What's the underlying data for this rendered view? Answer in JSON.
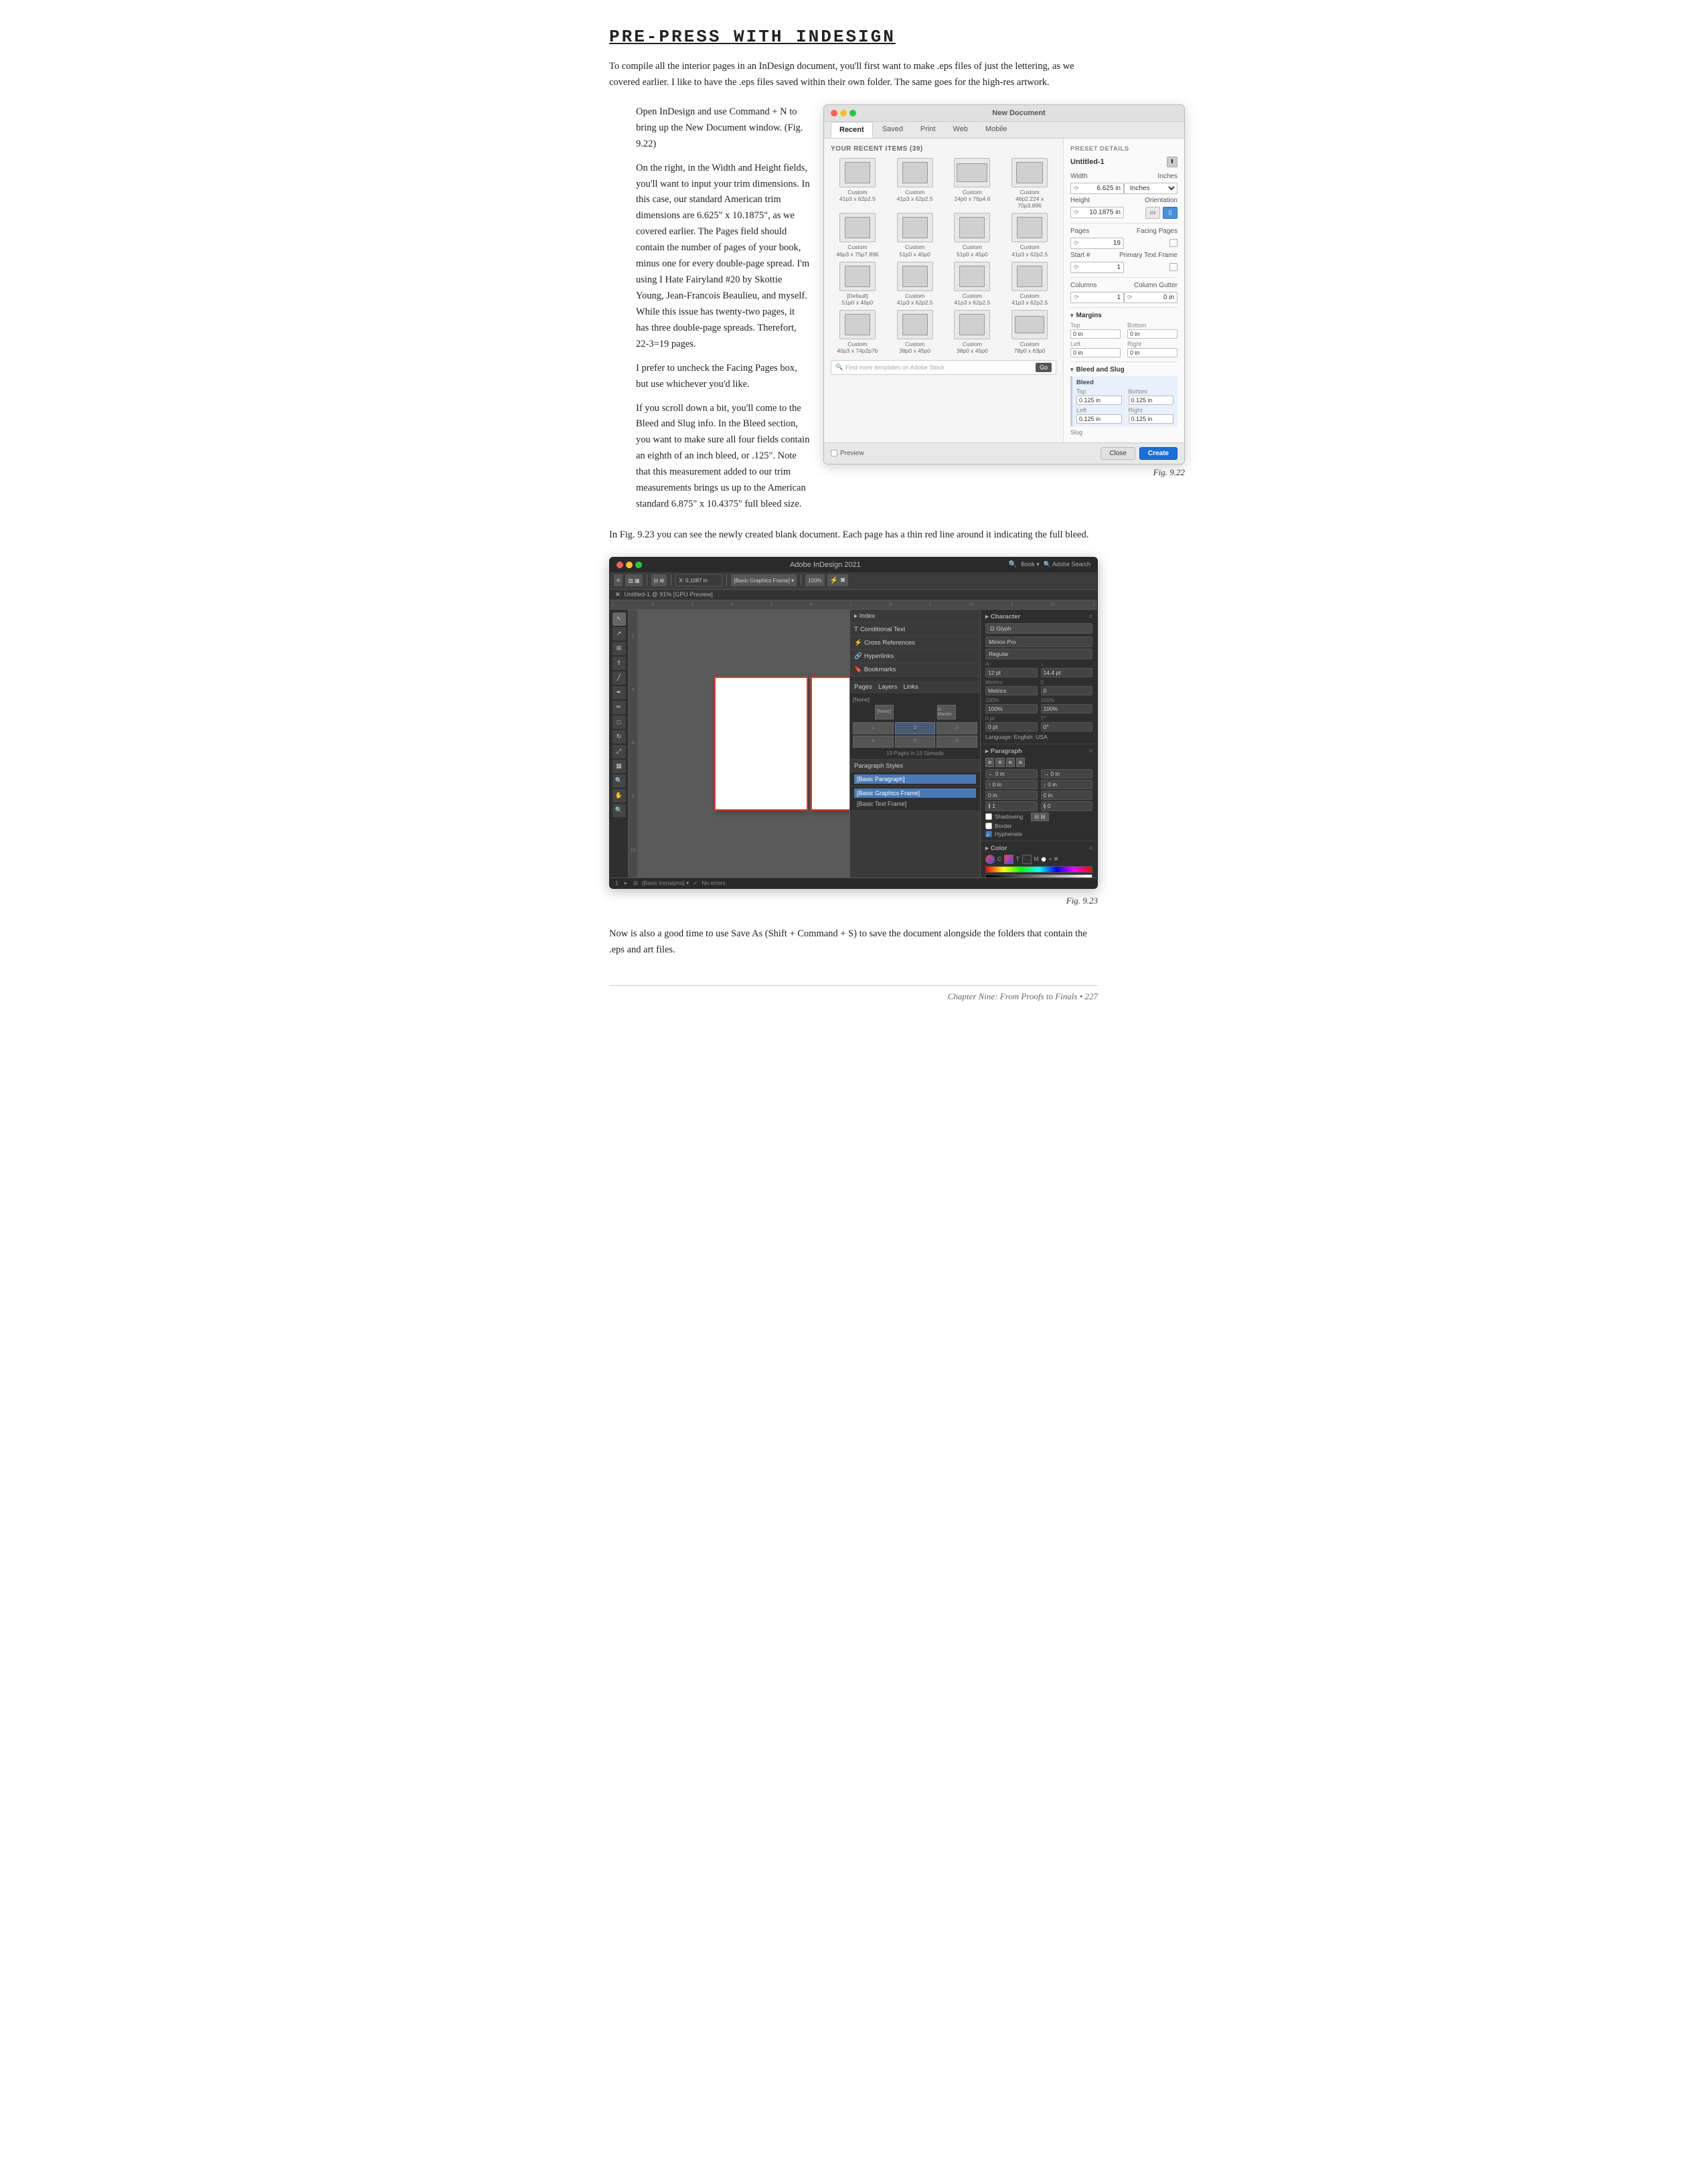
{
  "page": {
    "title": "PRE-PRESS WITH INDESIGN",
    "chapter_footer": "Chapter Nine: From Proofs to Finals  •  227"
  },
  "paragraphs": {
    "intro": "To compile all the interior pages in an InDesign document, you'll first want to make .eps files of just the lettering, as we covered earlier. I like to have the .eps files saved within their own folder. The same goes for the high-res artwork.",
    "p1": "Open InDesign and use Command + N to bring up the New Document window. (Fig. 9.22)",
    "p2": "On the right, in the Width and Height fields, you'll want to input your trim dimensions. In this case, our standard American trim dimensions are 6.625\" x 10.1875\", as we covered earlier. The Pages field should contain the number of pages of your book, minus one for every double-page spread. I'm using I Hate Fairyland #20 by Skottie Young, Jean-Francois Beaulieu, and myself. While this issue has twenty-two pages, it has three double-page spreads. Therefort, 22-3=19 pages.",
    "p3": "I prefer to uncheck the Facing Pages box, but use whichever you'd like.",
    "p4": "If you scroll down a bit, you'll come to the Bleed and Slug info. In the Bleed section, you want to make sure all four fields contain an eighth of an inch bleed, or .125\". Note that this measurement added to our trim measurements brings us up to the American standard 6.875\" x 10.4375\" full bleed size.",
    "fig_caption_1": "Fig. 9.22",
    "p5_intro": "In Fig. 9.23 you can see the newly created blank document. Each page has a thin red line around it indicating the full bleed.",
    "fig_caption_2": "Fig. 9.23",
    "footer_text": "Now is also a good time to use Save As (Shift + Command + S) to save the document alongside the folders that contain the .eps and art files."
  },
  "dialog": {
    "title": "New Document",
    "tabs": [
      "Recent",
      "Saved",
      "Print",
      "Web",
      "Mobile"
    ],
    "active_tab": "Recent",
    "recent_label": "YOUR RECENT ITEMS (39)",
    "templates": [
      {
        "label": "Custom\n41p3 x 62p2.5",
        "size": "small"
      },
      {
        "label": "Custom\n41p3 x 62p2.5",
        "size": "small"
      },
      {
        "label": "Custom\n24p0 x 76p4.6",
        "size": "medium"
      },
      {
        "label": "Custom\n46p2.224 x 70p3.896",
        "size": "medium"
      },
      {
        "label": "Custom\n46p3.544 x 75p7.896",
        "size": "small"
      },
      {
        "label": "Custom\n51p0 x 45p0",
        "size": "small"
      },
      {
        "label": "Custom\n51p0 x 45p0",
        "size": "small"
      },
      {
        "label": "Custom\n41p3 x 62p2.5",
        "size": "small"
      },
      {
        "label": "[Default]\n51p0 x 46p0",
        "size": "small"
      },
      {
        "label": "Custom\n41p3 x 62p2.5",
        "size": "small"
      },
      {
        "label": "Custom\n41p3 x 62p2.5",
        "size": "small"
      },
      {
        "label": "Custom\n41p3 x 62p2.5",
        "size": "small"
      },
      {
        "label": "Custom\n40p3.446 x 74p2p7b",
        "size": "small"
      },
      {
        "label": "Custom\n38p0 x 45p0",
        "size": "small"
      },
      {
        "label": "Custom\n38p0 x 45p0",
        "size": "small"
      },
      {
        "label": "Custom\n78p0 x 63p0",
        "size": "small"
      }
    ],
    "find_placeholder": "Find more templates on Adobe Stock",
    "go_label": "Go",
    "preset": {
      "label": "PRESET DETAILS",
      "name": "Untitled-1",
      "save_icon": "💾",
      "width_label": "Width",
      "width_value": "6.625 in",
      "units_label": "Inches",
      "height_label": "Height",
      "height_value": "10.1875 in",
      "orientation_label": "Orientation",
      "pages_label": "Pages",
      "pages_value": "19",
      "facing_pages_label": "Facing Pages",
      "start_label": "Start #",
      "start_value": "1",
      "primary_tf_label": "Primary Text Frame",
      "columns_label": "Columns",
      "columns_value": "1",
      "gutter_label": "Column Gutter",
      "gutter_value": "0 in",
      "margins_section": "Margins",
      "top_label": "Top",
      "top_value": "0 in",
      "bottom_label": "Bottom",
      "bottom_value": "0 in",
      "left_label": "Left",
      "left_value": "0 in",
      "right_label": "Right",
      "right_value": "0 in",
      "bleed_slug_section": "Bleed and Slug",
      "bleed_label": "Bleed",
      "bleed_top": "0.125 in",
      "bleed_bottom": "0.125 in",
      "bleed_left": "0.125 in",
      "bleed_right": "0.125 in",
      "slug_label": "Slug"
    },
    "preview_label": "Preview",
    "close_label": "Close",
    "create_label": "Create"
  },
  "app": {
    "title": "Adobe InDesign 2021",
    "file_name": "Untitled-1 @ 91% [GPU Preview]",
    "zoom": "100%",
    "page_info": "19 Pages in 13 Spreads",
    "panels": {
      "index_label": "Index",
      "conditional_text_label": "Conditional Text",
      "cross_references_label": "Cross References",
      "hyperlinks_label": "Hyperlinks",
      "bookmarks_label": "Bookmarks",
      "a_master_label": "A-Master",
      "none_label": "[None]"
    },
    "tabs": {
      "pages": "Pages",
      "layers": "Layers",
      "links": "Links"
    },
    "properties": {
      "character_label": "Character",
      "font_label": "Minion Pro",
      "style_label": "Regular",
      "size_label": "12 pt",
      "leading_label": "14.4 pt",
      "paragraph_label": "Paragraph",
      "shadowing_label": "Shadowing",
      "border_label": "Border",
      "hyphenate_label": "Hyphenate",
      "language_label": "Language: English: USA",
      "color_label": "Color"
    },
    "styles": {
      "paragraph_styles_label": "Paragraph Styles",
      "basic_paragraph": "[Basic Paragraph]",
      "basic_graphics_frame": "[Basic Graphics Frame]",
      "basic_text_frame": "[Basic Text Frame]"
    },
    "statusbar": {
      "page": "1",
      "total": "1",
      "errors": "No errors"
    }
  },
  "icons": {
    "arrow": "▸",
    "triangle_down": "▾",
    "check": "✓",
    "link": "🔗",
    "eye": "👁",
    "pages": "📄",
    "gear": "⚙",
    "search": "🔍"
  }
}
